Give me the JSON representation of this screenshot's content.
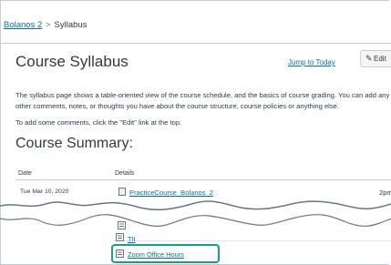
{
  "breadcrumb": {
    "course": "Bolanos 2",
    "separator": ">",
    "current": "Syllabus"
  },
  "page": {
    "title": "Course Syllabus",
    "jump_link": "Jump to Today",
    "edit_label": "Edit",
    "description": "The syllabus page shows a table-oriented view of the course schedule, and the basics of course grading. You can add any other comments, notes, or thoughts you have about the course structure, course policies or anything else.",
    "edit_hint": "To add some comments, click the \"Edit\" link at the top.",
    "summary_title": "Course Summary:"
  },
  "table": {
    "headers": {
      "date": "Date",
      "details": "Details"
    },
    "rows": [
      {
        "date": "Tue Mar 10, 2020",
        "item": "PracticeCourse_Bolanos_2",
        "time": "2pm"
      }
    ],
    "items_after_gap": [
      {
        "label": "TII",
        "icon": "assignment-icon"
      },
      {
        "label": "Zoom Office Hours",
        "icon": "assignment-icon",
        "highlighted": true
      }
    ]
  },
  "colors": {
    "link": "#0770a3",
    "highlight": "#16a085",
    "text": "#2d3b45"
  }
}
